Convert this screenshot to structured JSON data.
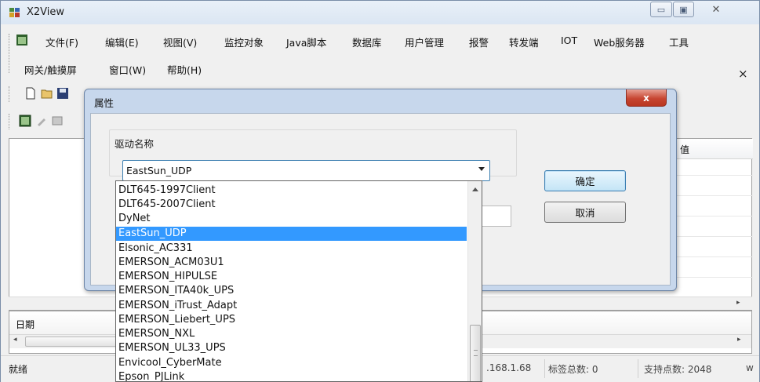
{
  "app": {
    "title": "X2View",
    "caption_min": "▭",
    "caption_max": "▣",
    "caption_close": "✕"
  },
  "menus": [
    "文件(F)",
    "编辑(E)",
    "视图(V)",
    "监控对象",
    "Java脚本",
    "数据库",
    "用户管理",
    "报警",
    "转发端",
    "IOT",
    "Web服务器",
    "工具",
    "网关/触摸屏",
    "窗口(W)",
    "帮助(H)"
  ],
  "menu_close": "×",
  "list_header": {
    "value_col": "值"
  },
  "bottom_panel": {
    "date_col": "日期"
  },
  "status": {
    "ready": "就绪",
    "ip": ".168.1.68",
    "tag_total": "标签总数: 0",
    "support_points": "支持点数: 2048",
    "tail": "w"
  },
  "dialog": {
    "title": "属性",
    "close_label": "x",
    "group_label": "驱动名称",
    "combo_value": "EastSun_UDP",
    "ok_label": "确定",
    "cancel_label": "取消"
  },
  "dropdown": {
    "items": [
      "DLT645-1997Client",
      "DLT645-2007Client",
      "DyNet",
      "EastSun_UDP",
      "Elsonic_AC331",
      "EMERSON_ACM03U1",
      "EMERSON_HIPULSE",
      "EMERSON_ITA40k_UPS",
      "EMERSON_iTrust_Adapt",
      "EMERSON_Liebert_UPS",
      "EMERSON_NXL",
      "EMERSON_UL33_UPS",
      "Envicool_CyberMate",
      "Epson_PJLink"
    ],
    "selected_index": 3
  },
  "colors": {
    "selection": "#3399ff",
    "dialog_frame": "#c7d7ec",
    "close_red": "#c74632"
  }
}
